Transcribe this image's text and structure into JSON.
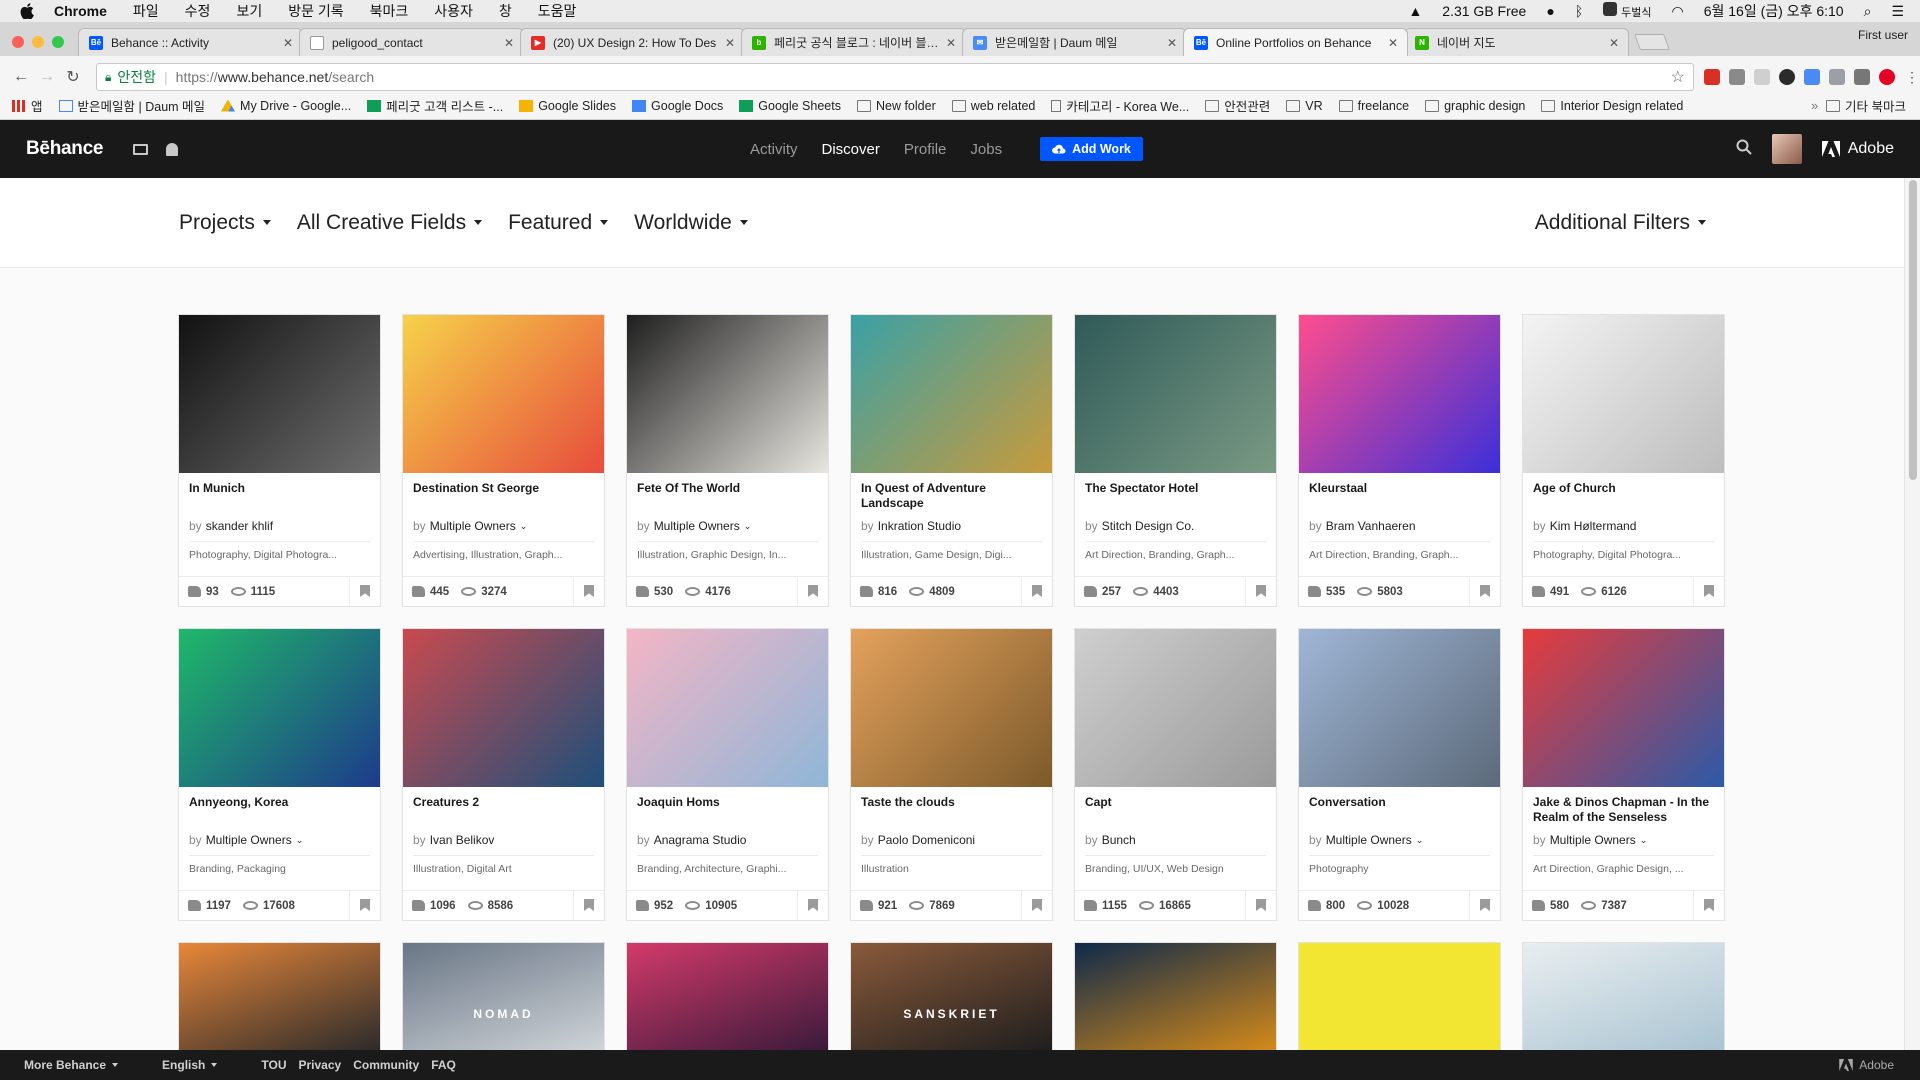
{
  "menubar": {
    "app": "Chrome",
    "items": [
      "파일",
      "수정",
      "보기",
      "방문 기록",
      "북마크",
      "사용자",
      "창",
      "도움말"
    ],
    "storage": "2.31 GB Free",
    "ime": "두벌식",
    "datetime": "6월 16일 (금) 오후 6:10"
  },
  "tabs": [
    {
      "title": "Behance :: Activity",
      "color": "#0057ff",
      "glyph": "Bē"
    },
    {
      "title": "peligood_contact",
      "color": "#ffffff",
      "glyph": ""
    },
    {
      "title": "(20) UX Design 2: How To Des",
      "color": "#e52d27",
      "glyph": "▶"
    },
    {
      "title": "페리굿 공식 블로그 : 네이버 블로그",
      "color": "#2db400",
      "glyph": "b"
    },
    {
      "title": "받은메일함 | Daum 메일",
      "color": "#4a8af4",
      "glyph": "✉"
    },
    {
      "title": "Online Portfolios on Behance",
      "color": "#0057ff",
      "glyph": "Bē"
    },
    {
      "title": "네이버 지도",
      "color": "#2db400",
      "glyph": "N"
    }
  ],
  "first_user": "First user",
  "address": {
    "secure_label": "안전함",
    "scheme": "https://",
    "host": "www.behance.net",
    "path": "/search"
  },
  "bookmarks": [
    {
      "label": "앱",
      "icon": "apps-icon"
    },
    {
      "label": "받은메일함 | Daum 메일",
      "icon": "mail-icon"
    },
    {
      "label": "My Drive - Google...",
      "icon": "drive-icon"
    },
    {
      "label": "페리굿 고객 리스트 -...",
      "icon": "sheets-icon"
    },
    {
      "label": "Google Slides",
      "icon": "slides-icon"
    },
    {
      "label": "Google Docs",
      "icon": "docs-icon"
    },
    {
      "label": "Google Sheets",
      "icon": "sheets-icon"
    },
    {
      "label": "New folder",
      "icon": "folder-icon"
    },
    {
      "label": "web related",
      "icon": "folder-icon"
    },
    {
      "label": "카테고리 - Korea We...",
      "icon": "page-icon"
    },
    {
      "label": "안전관련",
      "icon": "folder-icon"
    },
    {
      "label": "VR",
      "icon": "folder-icon"
    },
    {
      "label": "freelance",
      "icon": "folder-icon"
    },
    {
      "label": "graphic design",
      "icon": "folder-icon"
    },
    {
      "label": "Interior Design related",
      "icon": "folder-icon"
    }
  ],
  "bookmarks_more": "기타 북마크",
  "header": {
    "logo": "Bēhance",
    "nav": [
      {
        "label": "Activity",
        "active": false
      },
      {
        "label": "Discover",
        "active": true
      },
      {
        "label": "Profile",
        "active": false
      },
      {
        "label": "Jobs",
        "active": false
      }
    ],
    "add_work": "Add Work",
    "adobe": "Adobe"
  },
  "filters": {
    "projects": "Projects",
    "fields": "All Creative Fields",
    "featured": "Featured",
    "worldwide": "Worldwide",
    "additional": "Additional Filters"
  },
  "colors": {
    "accent": "#0057ff",
    "header_bg": "#191919"
  },
  "projects": [
    {
      "title": "In Munich",
      "owner": "skander khlif",
      "multiple": false,
      "fields": "Photography, Digital Photogra...",
      "likes": "93",
      "views": "1115",
      "bg": [
        "#111111",
        "#6e6e6e"
      ]
    },
    {
      "title": "Destination St George",
      "owner": "Multiple Owners",
      "multiple": true,
      "fields": "Advertising, Illustration, Graph...",
      "likes": "445",
      "views": "3274",
      "bg": [
        "#f6d24a",
        "#e74c3c"
      ]
    },
    {
      "title": "Fete Of The World",
      "owner": "Multiple Owners",
      "multiple": true,
      "fields": "Illustration, Graphic Design, In...",
      "likes": "530",
      "views": "4176",
      "bg": [
        "#1e1e1e",
        "#e8e6e0"
      ]
    },
    {
      "title": "In Quest of Adventure Landscape",
      "owner": "Inkration Studio",
      "multiple": false,
      "fields": "Illustration, Game Design, Digi...",
      "likes": "816",
      "views": "4809",
      "bg": [
        "#3aa1a6",
        "#c99a3b"
      ]
    },
    {
      "title": "The Spectator Hotel",
      "owner": "Stitch Design Co.",
      "multiple": false,
      "fields": "Art Direction, Branding, Graph...",
      "likes": "257",
      "views": "4403",
      "bg": [
        "#2f5a58",
        "#7a9a84"
      ]
    },
    {
      "title": "Kleurstaal",
      "owner": "Bram Vanhaeren",
      "multiple": false,
      "fields": "Art Direction, Branding, Graph...",
      "likes": "535",
      "views": "5803",
      "bg": [
        "#ff4d8d",
        "#3b2fd9"
      ]
    },
    {
      "title": "Age of Church",
      "owner": "Kim Høltermand",
      "multiple": false,
      "fields": "Photography, Digital Photogra...",
      "likes": "491",
      "views": "6126",
      "bg": [
        "#f4f4f4",
        "#bdbdbd"
      ]
    },
    {
      "title": "Annyeong, Korea",
      "owner": "Multiple Owners",
      "multiple": true,
      "fields": "Branding, Packaging",
      "likes": "1197",
      "views": "17608",
      "bg": [
        "#1fb86a",
        "#1d3b8a"
      ]
    },
    {
      "title": "Creatures 2",
      "owner": "Ivan Belikov",
      "multiple": false,
      "fields": "Illustration, Digital Art",
      "likes": "1096",
      "views": "8586",
      "bg": [
        "#c94a4f",
        "#1d4f7a"
      ]
    },
    {
      "title": "Joaquin Homs",
      "owner": "Anagrama Studio",
      "multiple": false,
      "fields": "Branding, Architecture, Graphi...",
      "likes": "952",
      "views": "10905",
      "bg": [
        "#f3b6c5",
        "#8fb6d8"
      ]
    },
    {
      "title": "Taste the clouds",
      "owner": "Paolo Domeniconi",
      "multiple": false,
      "fields": "Illustration",
      "likes": "921",
      "views": "7869",
      "bg": [
        "#e4a25c",
        "#7c5a2a"
      ]
    },
    {
      "title": "Capt",
      "owner": "Bunch",
      "multiple": false,
      "fields": "Branding, UI/UX, Web Design",
      "likes": "1155",
      "views": "16865",
      "bg": [
        "#cfcfcf",
        "#9a9a9a"
      ]
    },
    {
      "title": "Conversation",
      "owner": "Multiple Owners",
      "multiple": true,
      "fields": "Photography",
      "likes": "800",
      "views": "10028",
      "bg": [
        "#9fb6d6",
        "#5c6a7a"
      ]
    },
    {
      "title": "Jake & Dinos Chapman - In the Realm of the Senseless",
      "owner": "Multiple Owners",
      "multiple": true,
      "fields": "Art Direction, Graphic Design, ...",
      "likes": "580",
      "views": "7387",
      "bg": [
        "#e73b3b",
        "#2b5aa8"
      ]
    }
  ],
  "partial_thumbs": [
    {
      "bg": [
        "#e8873a",
        "#2a2a2a"
      ]
    },
    {
      "bg": [
        "#6a7686",
        "#cfd4d8"
      ],
      "label": "NOMAD"
    },
    {
      "bg": [
        "#d33a6a",
        "#3a1a3a"
      ]
    },
    {
      "bg": [
        "#8a5a3a",
        "#1e1e1e"
      ],
      "label": "SANSKRIET"
    },
    {
      "bg": [
        "#0f2a4a",
        "#d48a1a"
      ]
    },
    {
      "bg": [
        "#f2e633",
        "#f2e633"
      ]
    },
    {
      "bg": [
        "#e9eef0",
        "#aac4d2"
      ]
    }
  ],
  "footer": {
    "more": "More Behance",
    "lang": "English",
    "links": [
      "TOU",
      "Privacy",
      "Community",
      "FAQ"
    ],
    "adobe": "Adobe"
  }
}
